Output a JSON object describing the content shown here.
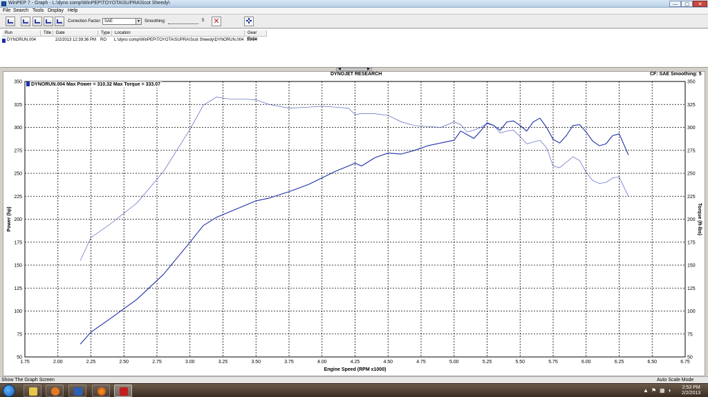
{
  "window": {
    "title": "WinPEP 7 - Graph - L:\\dyno comp\\WinPEP\\TOYOTA\\SUPRA\\Scot Sheedy\\",
    "min_label": "—",
    "max_label": "▢",
    "close_label": "✕"
  },
  "menu": [
    "File",
    "Search",
    "Tools",
    "Display",
    "Help"
  ],
  "toolbar": {
    "correction_label": "Correction Factor:",
    "correction_value": "SAE",
    "smoothing_label": "Smoothing:",
    "smoothing_value": "5",
    "icons": [
      "graph-icon",
      "graph-overlay-icon",
      "graph-compare-icon",
      "graph-multi-icon",
      "graph-3d-icon",
      "clear-runs-icon",
      "cursor-crosshair-icon"
    ]
  },
  "run_list": {
    "columns": [
      "Run",
      "Title",
      "Date",
      "Type",
      "Location",
      "Gear Ratio"
    ],
    "rows": [
      {
        "run": "DYNORUN.004",
        "title": "",
        "date": "2/2/2013 12:39:36 PM",
        "type": "RO",
        "location": "L:\\dyno comp\\WinPEP\\TOYOTA\\SUPRA\\Scot Sheedy\\DYNORUN.004",
        "gear_ratio": "59.54"
      }
    ]
  },
  "graph": {
    "header": "DYNOJET RESEARCH",
    "cf_label": "CF: SAE  Smoothing: 5",
    "legend": "DYNORUN.004 Max Power = 310.32 Max Torque = 333.07",
    "series_color": "#1d2ea6"
  },
  "chart_data": {
    "type": "line",
    "xlabel": "Engine Speed (RPM x1000)",
    "ylabel": "Power (hp)",
    "y2label": "Torque (ft-lbs)",
    "xlim": [
      1.75,
      6.75
    ],
    "ylim": [
      50,
      350
    ],
    "xticks": [
      "1.75",
      "2.00",
      "2.25",
      "2.50",
      "2.75",
      "3.00",
      "3.25",
      "3.50",
      "3.75",
      "4.00",
      "4.25",
      "4.50",
      "4.75",
      "5.00",
      "5.25",
      "5.50",
      "5.75",
      "6.00",
      "6.25",
      "6.50",
      "6.75"
    ],
    "yticks": [
      "50",
      "75",
      "100",
      "125",
      "150",
      "175",
      "200",
      "225",
      "250",
      "275",
      "300",
      "325",
      "350"
    ],
    "grid": true,
    "series": [
      {
        "name": "Power",
        "x": [
          2.17,
          2.25,
          2.4,
          2.6,
          2.8,
          3.0,
          3.1,
          3.2,
          3.3,
          3.4,
          3.5,
          3.6,
          3.75,
          3.9,
          4.0,
          4.1,
          4.2,
          4.25,
          4.3,
          4.4,
          4.5,
          4.6,
          4.7,
          4.8,
          4.9,
          5.0,
          5.05,
          5.1,
          5.15,
          5.2,
          5.25,
          5.3,
          5.35,
          5.4,
          5.45,
          5.5,
          5.55,
          5.6,
          5.65,
          5.7,
          5.75,
          5.8,
          5.85,
          5.9,
          5.95,
          6.0,
          6.05,
          6.1,
          6.15,
          6.2,
          6.25,
          6.32
        ],
        "y": [
          64,
          77,
          92,
          113,
          140,
          175,
          193,
          202,
          208,
          214,
          220,
          223,
          230,
          238,
          245,
          252,
          258,
          261,
          258,
          267,
          272,
          271,
          275,
          280,
          283,
          286,
          296,
          292,
          288,
          296,
          305,
          302,
          297,
          306,
          307,
          302,
          296,
          306,
          310,
          300,
          287,
          283,
          291,
          302,
          303,
          295,
          285,
          280,
          282,
          291,
          293,
          270
        ]
      },
      {
        "name": "Torque",
        "x": [
          2.17,
          2.25,
          2.4,
          2.6,
          2.8,
          3.0,
          3.1,
          3.2,
          3.3,
          3.4,
          3.5,
          3.6,
          3.75,
          3.9,
          4.0,
          4.1,
          4.2,
          4.25,
          4.3,
          4.4,
          4.5,
          4.6,
          4.7,
          4.8,
          4.9,
          5.0,
          5.05,
          5.1,
          5.15,
          5.2,
          5.25,
          5.3,
          5.35,
          5.4,
          5.45,
          5.5,
          5.55,
          5.6,
          5.65,
          5.7,
          5.75,
          5.8,
          5.85,
          5.9,
          5.95,
          6.0,
          6.05,
          6.1,
          6.15,
          6.2,
          6.25,
          6.32
        ],
        "y": [
          155,
          180,
          195,
          218,
          252,
          298,
          324,
          333,
          331,
          331,
          330,
          325,
          321,
          322,
          323,
          322,
          321,
          314,
          315,
          315,
          313,
          306,
          302,
          301,
          300,
          306,
          303,
          295,
          297,
          300,
          304,
          302,
          294,
          296,
          297,
          290,
          282,
          284,
          286,
          278,
          258,
          256,
          262,
          268,
          264,
          251,
          242,
          239,
          240,
          245,
          246,
          225
        ]
      }
    ]
  },
  "status": {
    "left": "Show The Graph Screen",
    "right": "Auto Scale Mode"
  },
  "taskbar": {
    "time": "2:53 PM",
    "date": "2/2/2013"
  }
}
